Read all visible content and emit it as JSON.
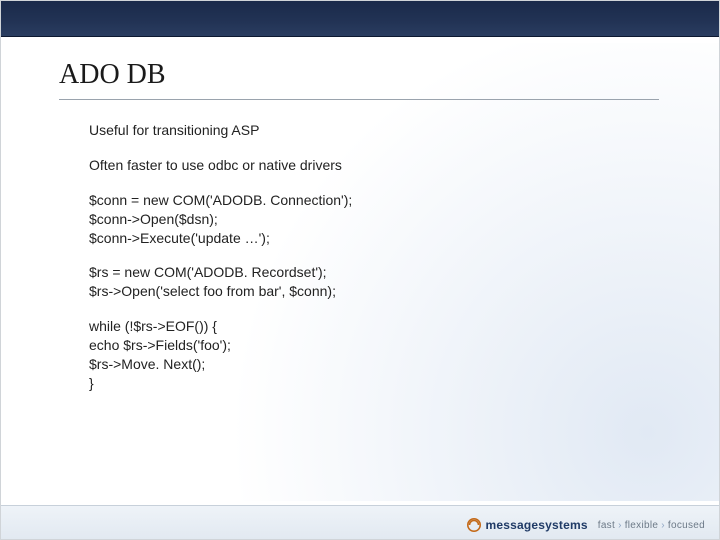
{
  "title": "ADO DB",
  "body": {
    "p1": "Useful for transitioning ASP",
    "p2": "Often faster to use odbc or native drivers",
    "p3": "$conn = new COM('ADODB. Connection');\n$conn->Open($dsn);\n$conn->Execute('update …');",
    "p4": "$rs = new COM('ADODB. Recordset');\n$rs->Open('select foo from bar', $conn);",
    "p5": "while (!$rs->EOF()) {\n   echo $rs->Fields('foo');\n   $rs->Move. Next();\n}"
  },
  "footer": {
    "brand": "messagesystems",
    "tag1": "fast",
    "tag2": "flexible",
    "tag3": "focused"
  }
}
